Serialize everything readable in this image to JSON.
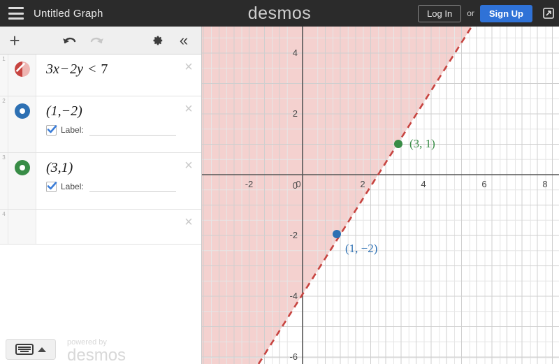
{
  "header": {
    "menu_icon": "hamburger-icon",
    "title": "Untitled Graph",
    "brand": "desmos",
    "login_label": "Log In",
    "or_label": "or",
    "signup_label": "Sign Up",
    "share_icon": "share-icon",
    "background": "#2b2b2b",
    "signup_color": "#2f72d7"
  },
  "toolbar": {
    "add_label": "+",
    "undo_icon": "undo-icon",
    "redo_icon": "redo-icon",
    "settings_icon": "gear-icon",
    "collapse_label": "«"
  },
  "expressions": [
    {
      "index": "1",
      "type": "inequality",
      "text": "3x − 2y < 7",
      "lhs": "3x",
      "minus": "−",
      "term2": "2y",
      "relation": "<",
      "rhs": "7",
      "color": "#c74440",
      "delete_label": "×",
      "has_label_row": false
    },
    {
      "index": "2",
      "type": "point",
      "text": "(1,−2)",
      "color": "#2d70b3",
      "delete_label": "×",
      "has_label_row": true,
      "label_caption": "Label:",
      "label_value": "",
      "label_checked": true
    },
    {
      "index": "3",
      "type": "point",
      "text": "(3,1)",
      "color": "#388c46",
      "delete_label": "×",
      "has_label_row": true,
      "label_caption": "Label:",
      "label_value": "",
      "label_checked": true
    },
    {
      "index": "4",
      "type": "empty",
      "text": "",
      "color": "",
      "delete_label": "×",
      "has_label_row": false
    }
  ],
  "footer": {
    "keyboard_icon": "keyboard-icon",
    "expand_icon": "caret-up-icon",
    "powered_by": "powered by",
    "powered_brand": "desmos"
  },
  "chart_data": {
    "type": "line",
    "title": "",
    "xlabel": "",
    "ylabel": "",
    "xlim": [
      -3.3,
      8.5
    ],
    "ylim": [
      -6.5,
      5.0
    ],
    "xticks": [
      -2,
      0,
      2,
      4,
      6,
      8
    ],
    "yticks": [
      4,
      2,
      0,
      -2,
      -4,
      -6
    ],
    "xtick_labels": [
      "-2",
      "0",
      "2",
      "4",
      "6",
      "8"
    ],
    "ytick_labels": [
      "4",
      "2",
      "0",
      "-2",
      "-4",
      "-6"
    ],
    "grid": true,
    "minor_grid_step": 0.5,
    "series": [
      {
        "name": "3x - 2y < 7",
        "type": "inequality",
        "boundary": "3x - 2y = 7",
        "slope": 1.5,
        "intercept": -3.5,
        "line_style": "dashed",
        "line_color": "#c74440",
        "shade_side": "above-left",
        "shade_color": "#eeb5b2",
        "shade_opacity": 0.55
      },
      {
        "name": "(1,-2)",
        "type": "point",
        "x": 1,
        "y": -2,
        "color": "#2d70b3",
        "label": "(1, −2)"
      },
      {
        "name": "(3,1)",
        "type": "point",
        "x": 3,
        "y": 1,
        "color": "#388c46",
        "label": "(3, 1)"
      }
    ]
  }
}
